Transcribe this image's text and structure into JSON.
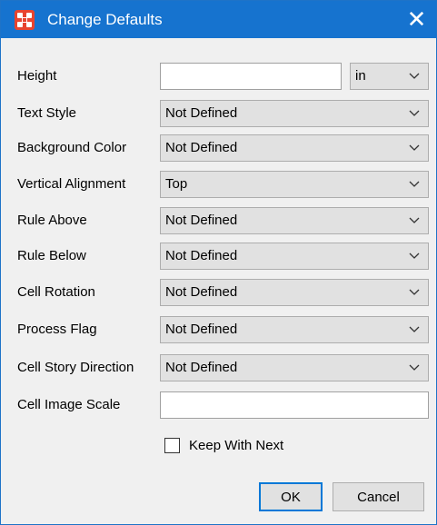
{
  "window": {
    "title": "Change Defaults",
    "icon": "app-logo-icon",
    "close_glyph": "✕",
    "title_bar_color": "#1673cf"
  },
  "form": {
    "height": {
      "label": "Height",
      "value": "",
      "unit": "in"
    },
    "text_style": {
      "label": "Text Style",
      "value": "Not Defined"
    },
    "background_color": {
      "label": "Background Color",
      "value": "Not Defined"
    },
    "vertical_alignment": {
      "label": "Vertical Alignment",
      "value": "Top"
    },
    "rule_above": {
      "label": "Rule Above",
      "value": "Not Defined"
    },
    "rule_below": {
      "label": "Rule Below",
      "value": "Not Defined"
    },
    "cell_rotation": {
      "label": "Cell Rotation",
      "value": "Not Defined"
    },
    "process_flag": {
      "label": "Process Flag",
      "value": "Not Defined"
    },
    "cell_story_direction": {
      "label": "Cell Story Direction",
      "value": "Not Defined"
    },
    "cell_image_scale": {
      "label": "Cell Image Scale",
      "value": ""
    },
    "keep_with_next": {
      "label": "Keep With Next",
      "checked": false
    }
  },
  "buttons": {
    "ok": "OK",
    "cancel": "Cancel"
  }
}
